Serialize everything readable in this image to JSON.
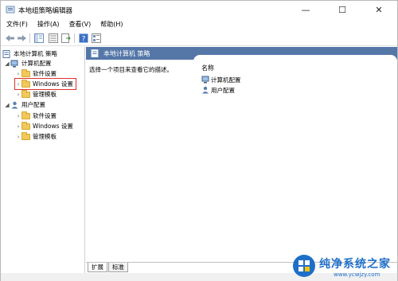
{
  "window": {
    "title": "本地组策略编辑器",
    "controls": {
      "minimize": "—",
      "maximize": "☐",
      "close": "✕"
    }
  },
  "menu": [
    "文件(F)",
    "操作(A)",
    "查看(V)",
    "帮助(H)"
  ],
  "toolbar": {
    "icons": [
      "back-arrow-icon",
      "forward-arrow-icon",
      "show-hide-tree-icon",
      "properties-icon",
      "export-list-icon",
      "help-icon",
      "filter-icon"
    ]
  },
  "tree": {
    "root": "本地计算机 策略",
    "computer_config": "计算机配置",
    "computer_children": [
      "软件设置",
      "Windows 设置",
      "管理模板"
    ],
    "user_config": "用户配置",
    "user_children": [
      "软件设置",
      "Windows 设置",
      "管理模板"
    ]
  },
  "right": {
    "header": "本地计算机 策略",
    "description": "选择一个项目来查看它的描述。",
    "column_name": "名称",
    "items": [
      "计算机配置",
      "用户配置"
    ]
  },
  "tabs": [
    "扩展",
    "标准"
  ],
  "watermark": {
    "text": "纯净系统之家",
    "url": "www.ycwjzy.com"
  },
  "colors": {
    "header_blue": "#5577a8",
    "folder_yellow": "#f1c85a",
    "highlight_red": "#e03030",
    "watermark_blue": "#1e6fc9"
  }
}
